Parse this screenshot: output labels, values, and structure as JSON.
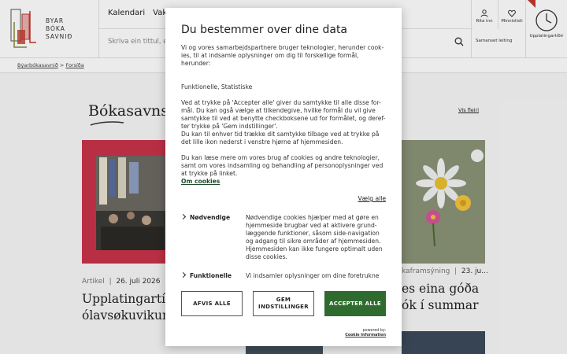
{
  "header": {
    "logo_text": [
      "BYAR",
      "BÓKA",
      "SAVNIÐ"
    ],
    "nav_items": [
      "Kalendari",
      "Vaks"
    ],
    "search_placeholder": "Skriva ein tittul, eitt",
    "utility": {
      "rita_inn": "Rita inn",
      "minnislisti": "Minnislisti",
      "samanset_leiting": "Samanset leiting",
      "upplatingartidir": "Upplatingartíðir"
    }
  },
  "breadcrumb": {
    "home": "Býarbókasavnið",
    "sep": ">",
    "current": "Forsíða"
  },
  "section": {
    "title": "Bókasavns",
    "see_more": "Vís fleiri"
  },
  "cards": {
    "left": {
      "category": "Artikel",
      "date": "26. juli 2026",
      "headline_lines": [
        "Upplatingartíð",
        "ólavsøkuvikun"
      ]
    },
    "right": {
      "category": "kaframsýning",
      "date": "23. ju...",
      "headline_lines": [
        "es eina góða",
        "ók í summar"
      ]
    }
  },
  "consent": {
    "title": "Du bestemmer over dine data",
    "intro": "Vi og vores samarbejdspartnere bruger teknologier, herunder cook-ies, til at indsamle oplysninger om dig til forskellige formål, herunder:",
    "purposes": "Funktionelle, Statistiske",
    "explain": "Ved at trykke på 'Accepter alle' giver du samtykke til alle disse for-mål. Du kan også vælge at tilkendegive, hvilke formål du vil give samtykke til ved at benytte checkboksene ud for formålet, og deref-ter trykke på 'Gem indstillinger'.",
    "withdraw": "Du kan til enhver tid trække dit samtykke tilbage ved at trykke på det lille ikon nederst i venstre hjørne af hjemmesiden.",
    "more": "Du kan læse mere om vores brug af cookies og andre teknologier, samt om vores indsamling og behandling af personoplysninger ved at trykke på linket.",
    "link_label": "Om cookies",
    "select_all": "Vælg alle",
    "categories": [
      {
        "name": "Nødvendige",
        "description": "Nødvendige cookies hjælper med at gøre en hjemmeside brugbar ved at aktivere grund-læggende funktioner, såsom side-navigation og adgang til sikre områder af hjemmesiden. Hjemmesiden kan ikke fungere optimalt uden disse cookies."
      },
      {
        "name": "Funktionelle",
        "description": "Vi indsamler oplysninger om dine foretrukne"
      }
    ],
    "buttons": {
      "reject": "AFVIS ALLE",
      "save": "GEM INDSTILLINGER",
      "accept": "ACCEPTER ALLE"
    },
    "powered_by": "powered by:",
    "powered_name": "Cookie Information"
  },
  "colors": {
    "accept_green": "#2f6b2f",
    "link_green": "#1e4b2a",
    "logo_red": "#c0392b",
    "logo_olive": "#8a8a3a"
  }
}
